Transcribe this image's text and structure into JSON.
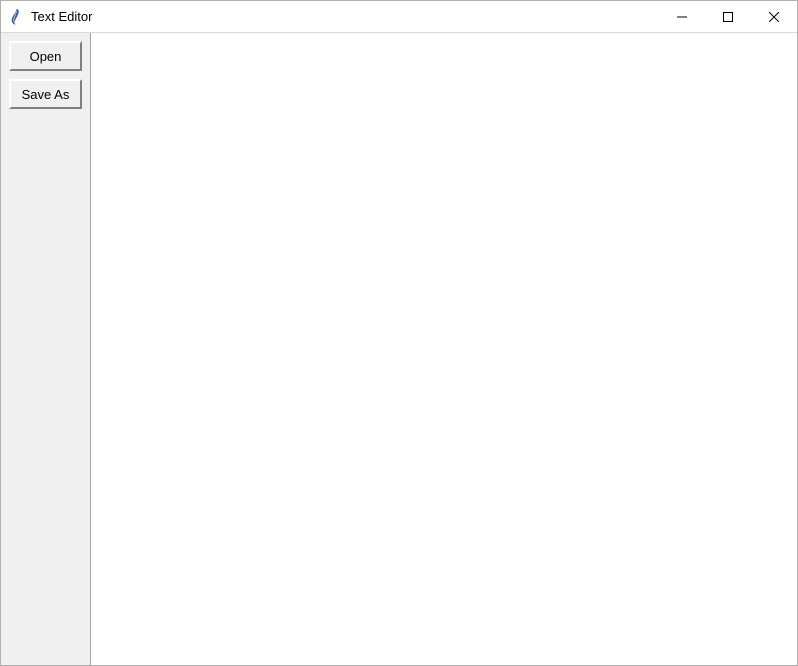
{
  "window": {
    "title": "Text Editor"
  },
  "sidebar": {
    "open_label": "Open",
    "save_as_label": "Save As"
  },
  "editor": {
    "content": ""
  }
}
